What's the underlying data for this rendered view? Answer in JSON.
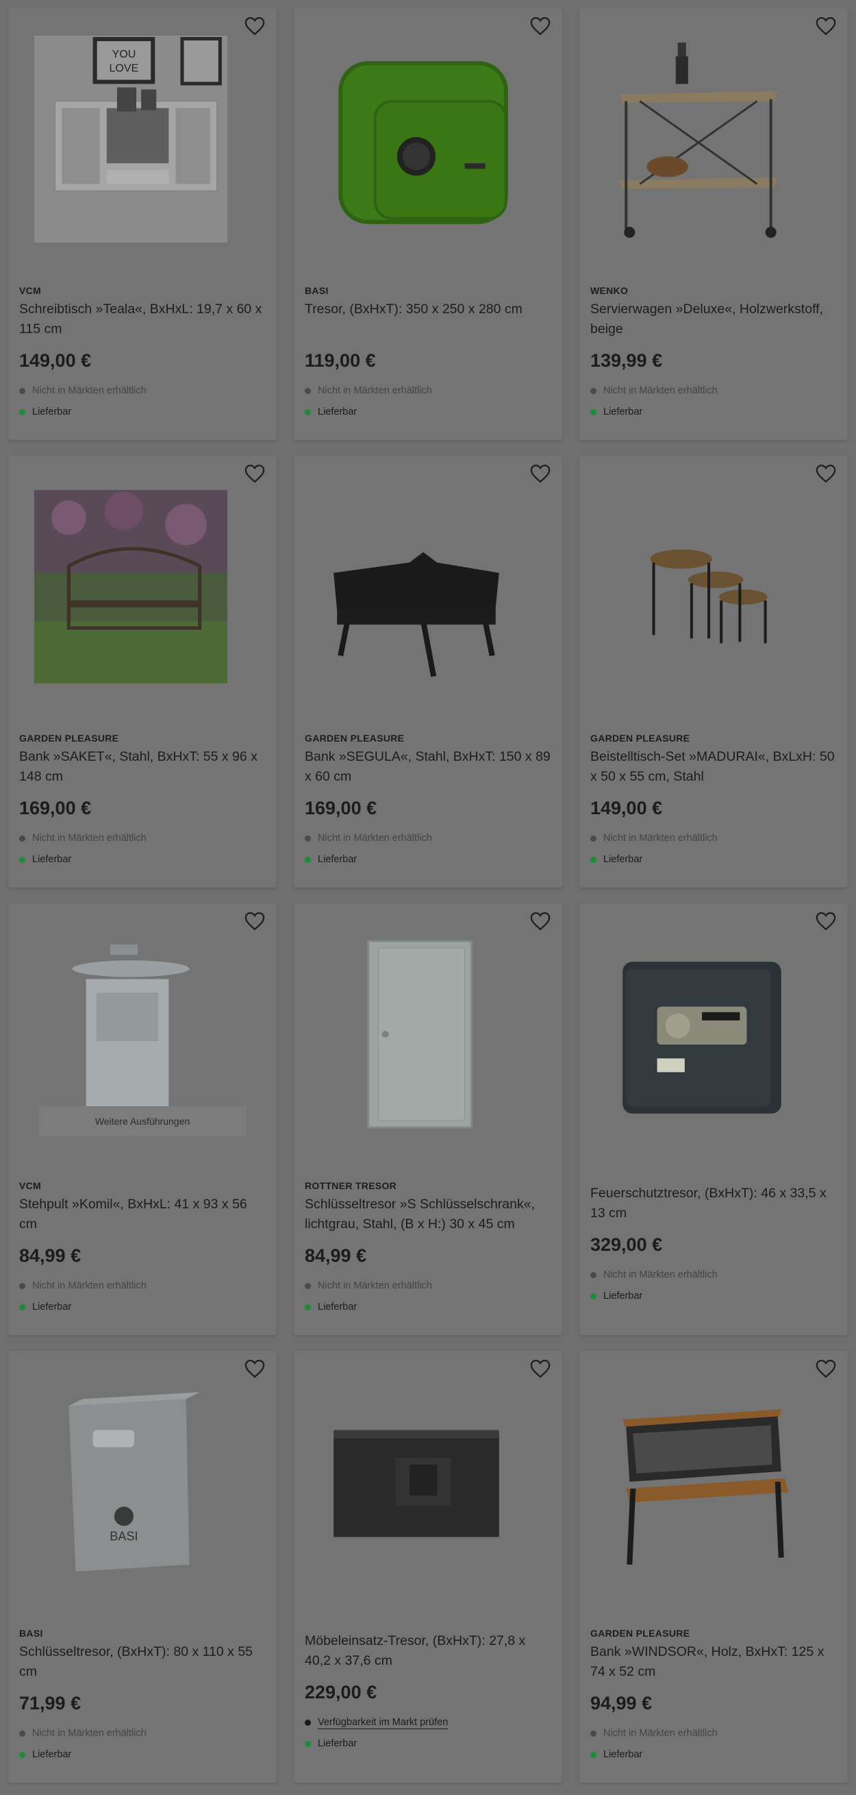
{
  "colors": {
    "backdrop": "#6f6f6f",
    "card": "#747474",
    "available_dot": "#1f8a3a",
    "unavailable_dot": "#4a4a4a"
  },
  "products": [
    {
      "brand": "VCM",
      "title": "Schreibtisch »Teala«, BxHxL: 19,7 x 60 x 115 cm",
      "price": "149,00 €",
      "stock": "Nicht in Märkten erhältlich",
      "delivery": "Lieferbar",
      "image": "wall-desk-image"
    },
    {
      "brand": "BASI",
      "title": "Tresor, (BxHxT): 350 x 250 x 280 cm",
      "price": "119,00 €",
      "stock": "Nicht in Märkten erhältlich",
      "delivery": "Lieferbar",
      "image": "green-safe-image"
    },
    {
      "brand": "WENKO",
      "title": "Servierwagen »Deluxe«, Holzwerkstoff, beige",
      "price": "139,99 €",
      "stock": "Nicht in Märkten erhältlich",
      "delivery": "Lieferbar",
      "image": "serving-cart-image"
    },
    {
      "brand": "GARDEN PLEASURE",
      "title": "Bank »SAKET«, Stahl, BxHxT: 55 x 96 x 148 cm",
      "price": "169,00 €",
      "stock": "Nicht in Märkten erhältlich",
      "delivery": "Lieferbar",
      "image": "garden-bench-photo"
    },
    {
      "brand": "GARDEN PLEASURE",
      "title": "Bank »SEGULA«, Stahl, BxHxT: 150 x 89 x 60 cm",
      "price": "169,00 €",
      "stock": "Nicht in Märkten erhältlich",
      "delivery": "Lieferbar",
      "image": "steel-bench-image"
    },
    {
      "brand": "GARDEN PLEASURE",
      "title": "Beistelltisch-Set »MADURAI«, BxLxH: 50 x 50 x 55 cm, Stahl",
      "price": "149,00 €",
      "stock": "Nicht in Märkten erhältlich",
      "delivery": "Lieferbar",
      "image": "side-tables-image"
    },
    {
      "brand": "VCM",
      "title": "Stehpult »Komil«, BxHxL: 41 x 93 x 56 cm",
      "price": "84,99 €",
      "stock": "Nicht in Märkten erhältlich",
      "delivery": "Lieferbar",
      "image": "standing-desk-image",
      "variants": "Weitere Ausführungen"
    },
    {
      "brand": "ROTTNER TRESOR",
      "title": "Schlüsseltresor »S Schlüsselschrank«, lichtgrau, Stahl, (B x H:) 30 x 45 cm",
      "price": "84,99 €",
      "stock": "Nicht in Märkten erhältlich",
      "delivery": "Lieferbar",
      "image": "key-cabinet-image"
    },
    {
      "brand": "",
      "title": "Feuerschutztresor, (BxHxT): 46 x 33,5 x 13 cm",
      "price": "329,00 €",
      "stock": "Nicht in Märkten erhältlich",
      "delivery": "Lieferbar",
      "image": "fire-safe-image"
    },
    {
      "brand": "BASI",
      "title": "Schlüsseltresor, (BxHxT): 80 x 110 x 55 cm",
      "price": "71,99 €",
      "stock": "Nicht in Märkten erhältlich",
      "delivery": "Lieferbar",
      "image": "key-safe-image"
    },
    {
      "brand": "",
      "title": "Möbeleinsatz-Tresor, (BxHxT): 27,8 x 40,2 x 37,6 cm",
      "price": "229,00 €",
      "stock": "Verfügbarkeit im Markt prüfen",
      "stock_is_link": true,
      "delivery": "Lieferbar",
      "image": "furniture-safe-image"
    },
    {
      "brand": "GARDEN PLEASURE",
      "title": "Bank »WINDSOR«, Holz, BxHxT: 125 x 74 x 52 cm",
      "price": "94,99 €",
      "stock": "Nicht in Märkten erhältlich",
      "delivery": "Lieferbar",
      "image": "windsor-bench-image"
    }
  ]
}
